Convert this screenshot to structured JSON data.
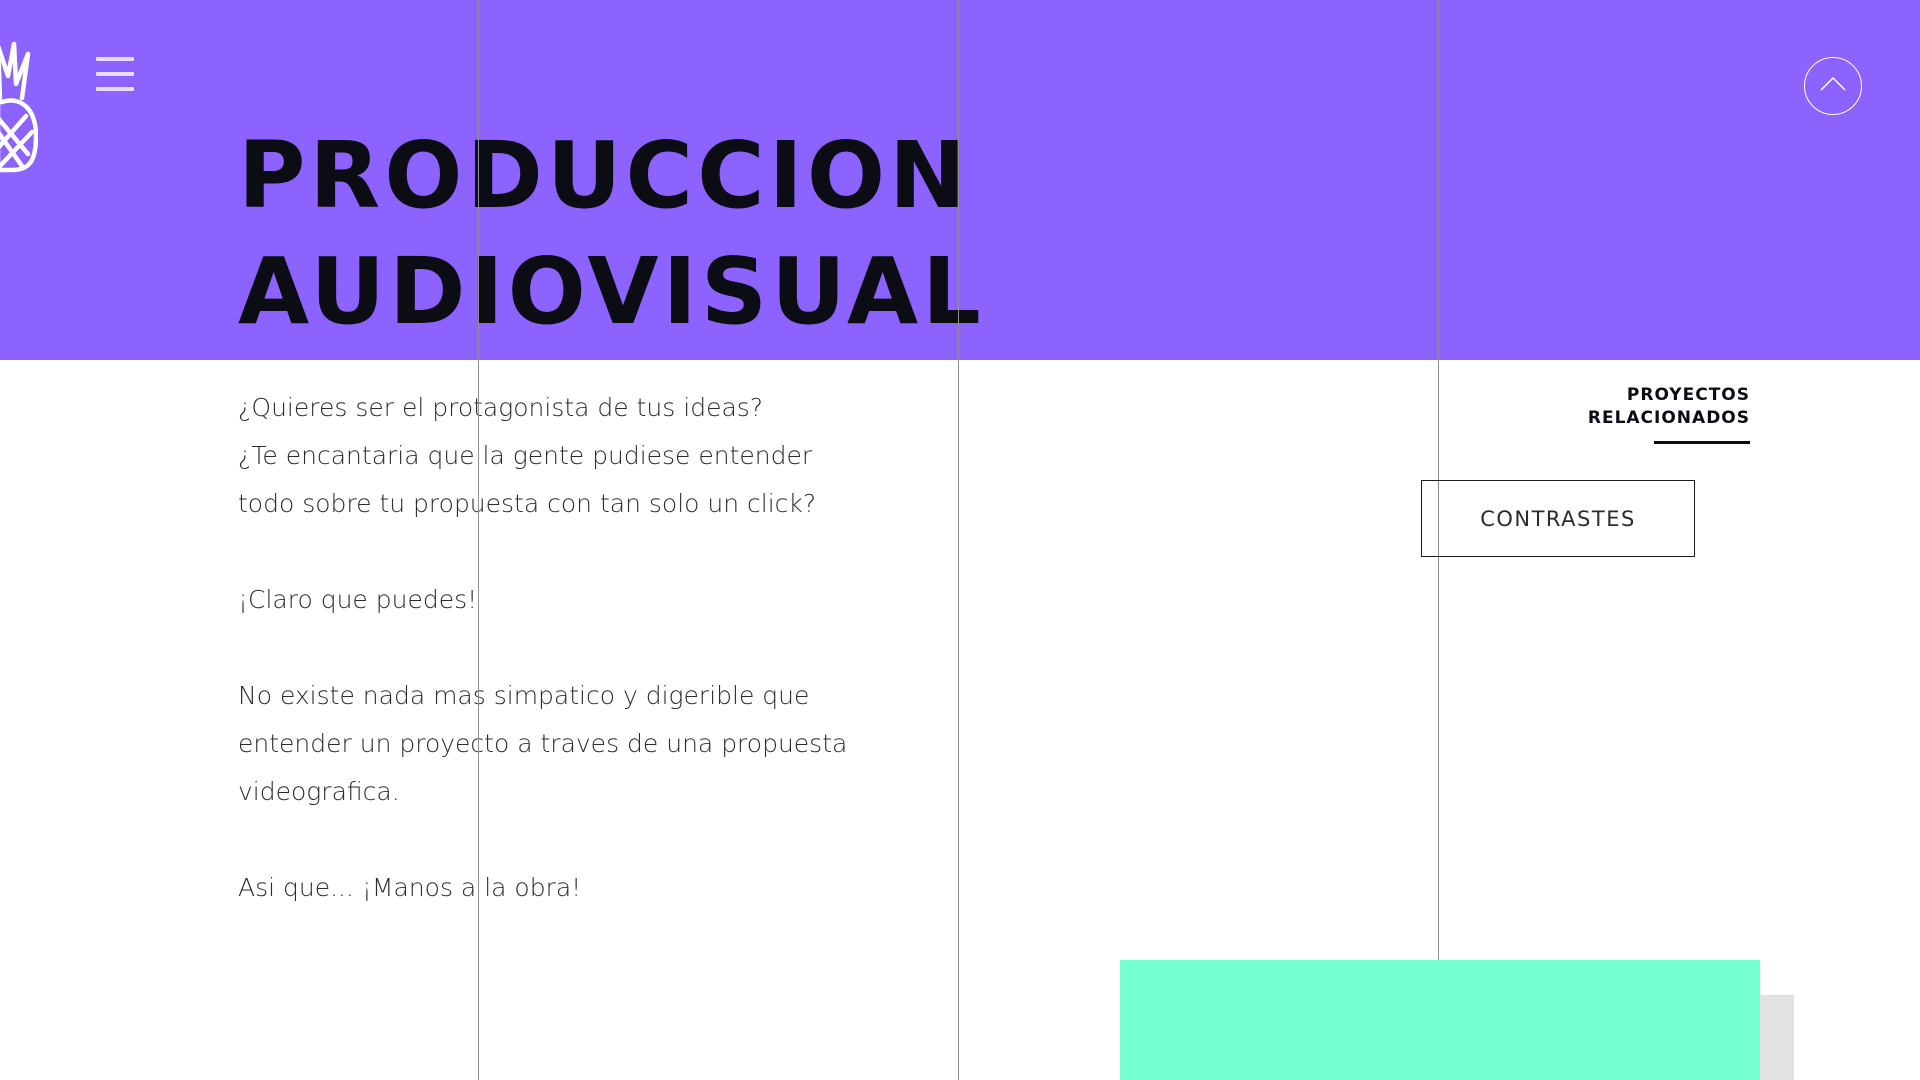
{
  "header": {
    "logo_icon": "pineapple-icon",
    "menu_icon": "hamburger-menu-icon",
    "scroll_top_icon": "chevron-up-icon"
  },
  "hero": {
    "title_line_1": "PRODUCCION",
    "title_line_2": "AUDIOVISUAL",
    "background_color": "#8c63ff"
  },
  "intro": {
    "line_1": "¿Quieres ser el protagonista de tus ideas?",
    "line_2": "¿Te encantaria que la gente pudiese entender",
    "line_3": "todo sobre tu propuesta con tan solo un click?",
    "paragraph_2": "¡Claro que puedes!",
    "paragraph_3_line_1": "No existe nada mas simpatico y digerible que",
    "paragraph_3_line_2": "entender un proyecto a traves de una propuesta",
    "paragraph_3_line_3": "videografica.",
    "paragraph_4": "Asi que... ¡Manos a la obra!"
  },
  "related": {
    "heading_line_1": "PROYECTOS",
    "heading_line_2": "RELACIONADOS",
    "projects": [
      {
        "label": "CONTRASTES"
      }
    ]
  },
  "colors": {
    "accent": "#8c63ff",
    "teal": "#74ffcf",
    "text": "#0c0c14"
  }
}
